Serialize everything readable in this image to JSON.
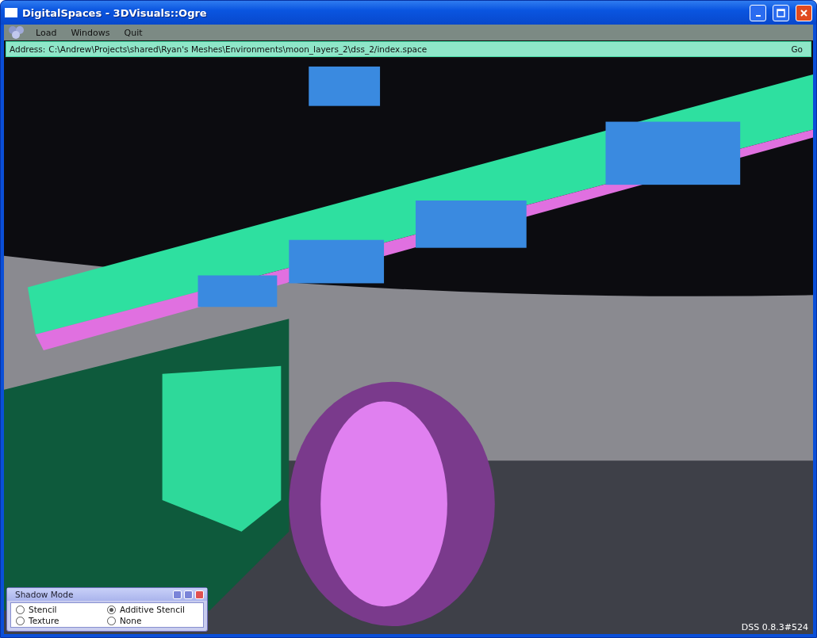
{
  "window": {
    "title": "DigitalSpaces - 3DVisuals::Ogre"
  },
  "menu": [
    "Load",
    "Windows",
    "Quit"
  ],
  "address_bar": {
    "label": "Address:",
    "value": "C:\\Andrew\\Projects\\shared\\Ryan's Meshes\\Environments\\moon_layers_2\\dss_2/index.space",
    "button": "Go"
  },
  "shadow_mode_panel": {
    "title": "Shadow Mode",
    "options": [
      {
        "label": "Stencil",
        "selected": false
      },
      {
        "label": "Additive Stencil",
        "selected": true
      },
      {
        "label": "Texture",
        "selected": false
      },
      {
        "label": "None",
        "selected": false
      }
    ]
  },
  "version": "DSS 0.8.3#524"
}
